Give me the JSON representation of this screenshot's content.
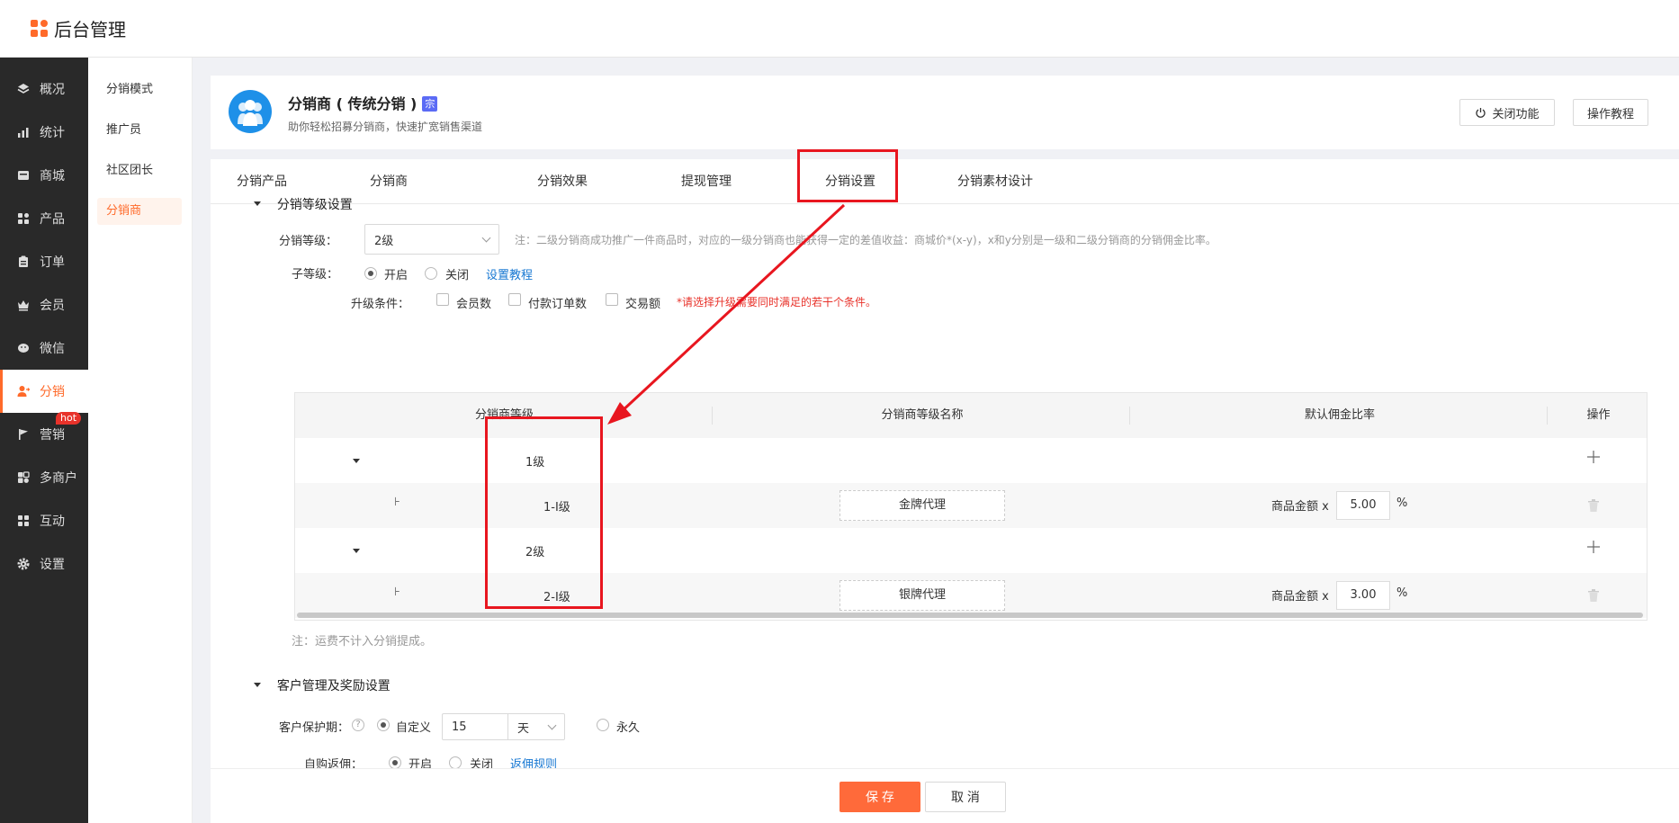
{
  "app": {
    "title": "后台管理"
  },
  "sidebar": {
    "items": [
      {
        "label": "概况",
        "icon": "layers-icon"
      },
      {
        "label": "统计",
        "icon": "chart-icon"
      },
      {
        "label": "商城",
        "icon": "store-icon"
      },
      {
        "label": "产品",
        "icon": "grid-icon"
      },
      {
        "label": "订单",
        "icon": "clipboard-icon"
      },
      {
        "label": "会员",
        "icon": "crown-icon"
      },
      {
        "label": "微信",
        "icon": "wechat-icon"
      },
      {
        "label": "分销",
        "icon": "user-share-icon",
        "active": true
      },
      {
        "label": "营销",
        "icon": "flag-icon",
        "badge": "hot"
      },
      {
        "label": "多商户",
        "icon": "shop-icon"
      },
      {
        "label": "互动",
        "icon": "apps-icon"
      },
      {
        "label": "设置",
        "icon": "gear-icon"
      }
    ]
  },
  "subnav": {
    "items": [
      {
        "label": "分销模式"
      },
      {
        "label": "推广员"
      },
      {
        "label": "社区团长"
      },
      {
        "label": "分销商",
        "active": true
      }
    ]
  },
  "header": {
    "title": "分销商 ( 传统分销 )",
    "tag": "宗",
    "subtitle": "助你轻松招募分销商，快速扩宽销售渠道",
    "close_label": "关闭功能",
    "tutorial_label": "操作教程"
  },
  "tabs": [
    {
      "label": "分销产品"
    },
    {
      "label": "分销商"
    },
    {
      "label": "分销效果"
    },
    {
      "label": "提现管理"
    },
    {
      "label": "分销设置",
      "active": true
    },
    {
      "label": "分销素材设计"
    }
  ],
  "level_section": {
    "title": "分销等级设置",
    "level_label": "分销等级：",
    "level_value": "2级",
    "level_note": "注：二级分销商成功推广一件商品时，对应的一级分销商也能获得一定的差值收益：商城价*(x-y)，x和y分别是一级和二级分销商的分销佣金比率。",
    "sublevel_label": "子等级：",
    "on_label": "开启",
    "off_label": "关闭",
    "tutorial_link": "设置教程",
    "upgrade_label": "升级条件：",
    "conditions": [
      "会员数",
      "付款订单数",
      "交易额"
    ],
    "upgrade_note": "*请选择升级需要同时满足的若干个条件。",
    "shipping_note": "注：运费不计入分销提成。"
  },
  "table": {
    "headers": [
      "分销商等级",
      "分销商等级名称",
      "默认佣金比率",
      "操作"
    ],
    "amount_label": "商品金额 x",
    "percent": "%",
    "rows": [
      {
        "level": "1级",
        "type": "parent"
      },
      {
        "level": "1-I级",
        "type": "child",
        "name": "金牌代理",
        "rate": "5.00"
      },
      {
        "level": "2级",
        "type": "parent"
      },
      {
        "level": "2-I级",
        "type": "child",
        "name": "银牌代理",
        "rate": "3.00"
      }
    ],
    "tree_branch": "⊦"
  },
  "customer_section": {
    "title": "客户管理及奖励设置",
    "protect_label": "客户保护期：",
    "custom_label": "自定义",
    "days_value": "15",
    "unit_value": "天",
    "forever_label": "永久",
    "self_buy_label": "自购返佣：",
    "on_label": "开启",
    "off_label": "关闭",
    "rule_link": "返佣规则"
  },
  "footer": {
    "save_label": "保 存",
    "cancel_label": "取 消"
  },
  "colors": {
    "accent": "#ff6a2a",
    "sidebar": "#292929",
    "highlight": "#e8161f",
    "link": "#1677d2"
  }
}
